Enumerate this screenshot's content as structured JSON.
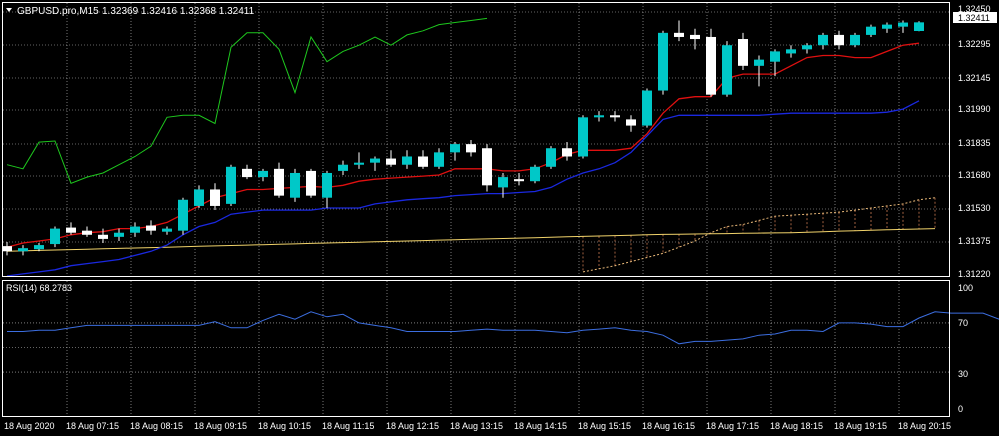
{
  "header": {
    "symbol_timeframe": "GBPUSD.pro,M15",
    "ohlc": "1.32369 1.32416 1.32368 1.32411",
    "menu_icon": "triangle-down-icon"
  },
  "price_axis": {
    "labels": [
      "1.32450",
      "1.32295",
      "1.32145",
      "1.31990",
      "1.31835",
      "1.31680",
      "1.31530",
      "1.31375",
      "1.31220"
    ],
    "current_price": "1.32411"
  },
  "rsi": {
    "label": "RSI(14) 68.2783",
    "levels": [
      "100",
      "70",
      "30",
      "0"
    ],
    "values": [
      63,
      63,
      64,
      64,
      66,
      68,
      68,
      68,
      68,
      68,
      68,
      68,
      68,
      71,
      66,
      66,
      72,
      77,
      73,
      79,
      75,
      77,
      70,
      68,
      66,
      63,
      63,
      63,
      63,
      64,
      65,
      64,
      64,
      64,
      63,
      62,
      64,
      65,
      66,
      64,
      63,
      60,
      53,
      55,
      55,
      56,
      57,
      60,
      61,
      64,
      64,
      63,
      70,
      70,
      69,
      67,
      67,
      74,
      79,
      78,
      78,
      78,
      73,
      63,
      67,
      66,
      65,
      65,
      66,
      67,
      66,
      65,
      65,
      65,
      66,
      67,
      64,
      67,
      67,
      66,
      67,
      67,
      68,
      68,
      68
    ]
  },
  "time_axis": {
    "labels": [
      "18 Aug 2020",
      "18 Aug 07:15",
      "18 Aug 08:15",
      "18 Aug 09:15",
      "18 Aug 10:15",
      "18 Aug 11:15",
      "18 Aug 12:15",
      "18 Aug 13:15",
      "18 Aug 14:15",
      "18 Aug 15:15",
      "18 Aug 16:15",
      "18 Aug 17:15",
      "18 Aug 18:15",
      "18 Aug 19:15",
      "18 Aug 20:15"
    ]
  },
  "colors": {
    "background": "#000000",
    "grid": "#c8c8c8",
    "candle_up": "#00c8c8",
    "candle_down": "#ffffff",
    "tenkan": "#e01010",
    "kijun": "#1a28e0",
    "chikou": "#1ec81e",
    "span_a": "#f0d26a",
    "span_b": "#e8b878",
    "cloud_hatch": "#c87850",
    "rsi_line": "#3c6ee0",
    "price_marker": "#ffffff"
  },
  "chart_data": {
    "type": "candlestick",
    "x_start": "18 Aug 2020 06:30",
    "interval": "15 minutes",
    "ylim": [
      1.3118,
      1.325
    ],
    "candles": [
      [
        1.31325,
        1.31345,
        1.3128,
        1.313
      ],
      [
        1.313,
        1.3133,
        1.3128,
        1.31315
      ],
      [
        1.3131,
        1.3134,
        1.313,
        1.3133
      ],
      [
        1.31335,
        1.3142,
        1.3132,
        1.3141
      ],
      [
        1.31415,
        1.3144,
        1.3138,
        1.3139
      ],
      [
        1.314,
        1.3142,
        1.3137,
        1.3138
      ],
      [
        1.3138,
        1.3141,
        1.3134,
        1.3136
      ],
      [
        1.3137,
        1.3141,
        1.3135,
        1.3139
      ],
      [
        1.3139,
        1.3144,
        1.3137,
        1.3142
      ],
      [
        1.31425,
        1.3145,
        1.3138,
        1.314
      ],
      [
        1.31395,
        1.3142,
        1.3138,
        1.3141
      ],
      [
        1.314,
        1.3156,
        1.3138,
        1.3155
      ],
      [
        1.3152,
        1.3162,
        1.3151,
        1.316
      ],
      [
        1.316,
        1.3163,
        1.315,
        1.3152
      ],
      [
        1.3153,
        1.3172,
        1.3152,
        1.3171
      ],
      [
        1.317,
        1.3172,
        1.3165,
        1.3166
      ],
      [
        1.3166,
        1.317,
        1.3164,
        1.3169
      ],
      [
        1.317,
        1.3173,
        1.3156,
        1.3157
      ],
      [
        1.3156,
        1.317,
        1.3154,
        1.3168
      ],
      [
        1.3169,
        1.317,
        1.3156,
        1.3157
      ],
      [
        1.3156,
        1.3169,
        1.3151,
        1.3168
      ],
      [
        1.3169,
        1.3174,
        1.3167,
        1.3172
      ],
      [
        1.3172,
        1.3178,
        1.317,
        1.3173
      ],
      [
        1.3173,
        1.3176,
        1.3169,
        1.3175
      ],
      [
        1.3175,
        1.3179,
        1.3171,
        1.3172
      ],
      [
        1.3172,
        1.3179,
        1.317,
        1.3176
      ],
      [
        1.3176,
        1.3179,
        1.317,
        1.3171
      ],
      [
        1.3171,
        1.318,
        1.317,
        1.3178
      ],
      [
        1.3178,
        1.3183,
        1.3174,
        1.3182
      ],
      [
        1.3182,
        1.3184,
        1.3176,
        1.3178
      ],
      [
        1.318,
        1.3182,
        1.3159,
        1.3162
      ],
      [
        1.3161,
        1.3168,
        1.3156,
        1.3166
      ],
      [
        1.3165,
        1.3168,
        1.3162,
        1.3164
      ],
      [
        1.3164,
        1.3172,
        1.3163,
        1.3171
      ],
      [
        1.3171,
        1.3181,
        1.317,
        1.318
      ],
      [
        1.318,
        1.3183,
        1.3174,
        1.3176
      ],
      [
        1.3176,
        1.3196,
        1.3175,
        1.3195
      ],
      [
        1.3195,
        1.3198,
        1.3193,
        1.3196
      ],
      [
        1.3196,
        1.3198,
        1.3193,
        1.3195
      ],
      [
        1.3194,
        1.3196,
        1.3188,
        1.3191
      ],
      [
        1.3191,
        1.3209,
        1.319,
        1.3208
      ],
      [
        1.3208,
        1.3237,
        1.3206,
        1.3236
      ],
      [
        1.3236,
        1.3242,
        1.3232,
        1.3234
      ],
      [
        1.3235,
        1.3238,
        1.3228,
        1.3233
      ],
      [
        1.3234,
        1.3238,
        1.3205,
        1.3206
      ],
      [
        1.3206,
        1.3232,
        1.3205,
        1.323
      ],
      [
        1.3233,
        1.3236,
        1.3218,
        1.322
      ],
      [
        1.322,
        1.3225,
        1.321,
        1.3223
      ],
      [
        1.3222,
        1.3228,
        1.3215,
        1.3227
      ],
      [
        1.3226,
        1.323,
        1.3224,
        1.3228
      ],
      [
        1.3228,
        1.3231,
        1.3226,
        1.323
      ],
      [
        1.323,
        1.3236,
        1.3228,
        1.3235
      ],
      [
        1.3235,
        1.3237,
        1.3228,
        1.323
      ],
      [
        1.323,
        1.3236,
        1.3229,
        1.3235
      ],
      [
        1.3235,
        1.324,
        1.3234,
        1.3239
      ],
      [
        1.3238,
        1.3241,
        1.3236,
        1.324
      ],
      [
        1.3239,
        1.3242,
        1.3236,
        1.3241
      ],
      [
        1.32369,
        1.32416,
        1.32368,
        1.32411
      ]
    ],
    "tenkan": [
      1.3132,
      1.3134,
      1.3135,
      1.3136,
      1.3138,
      1.3139,
      1.31395,
      1.3141,
      1.3141,
      1.3142,
      1.3144,
      1.3148,
      1.3152,
      1.3156,
      1.3158,
      1.316,
      1.316,
      1.31605,
      1.3161,
      1.31615,
      1.3161,
      1.3162,
      1.3164,
      1.3165,
      1.31655,
      1.3166,
      1.31665,
      1.3167,
      1.317,
      1.317,
      1.317,
      1.3169,
      1.3169,
      1.317,
      1.3173,
      1.3177,
      1.3179,
      1.3179,
      1.3179,
      1.318,
      1.3187,
      1.3197,
      1.3204,
      1.3205,
      1.3205,
      1.3214,
      1.3216,
      1.3216,
      1.3216,
      1.322,
      1.3224,
      1.3225,
      1.3225,
      1.3224,
      1.3224,
      1.3227,
      1.323,
      1.3231
    ],
    "kijun": [
      1.3118,
      1.3119,
      1.312,
      1.3121,
      1.3123,
      1.3124,
      1.3125,
      1.3126,
      1.3128,
      1.313,
      1.3133,
      1.3138,
      1.3142,
      1.3144,
      1.3148,
      1.3149,
      1.315,
      1.315,
      1.315,
      1.315,
      1.3151,
      1.3151,
      1.3151,
      1.3153,
      1.3154,
      1.3155,
      1.31555,
      1.3156,
      1.3157,
      1.31575,
      1.3158,
      1.3158,
      1.31585,
      1.3159,
      1.3161,
      1.3165,
      1.3168,
      1.317,
      1.3173,
      1.3178,
      1.3186,
      1.3194,
      1.3196,
      1.3196,
      1.3196,
      1.3196,
      1.3196,
      1.3196,
      1.31965,
      1.3197,
      1.3197,
      1.3197,
      1.3197,
      1.3197,
      1.3197,
      1.31975,
      1.3199,
      1.3203
    ],
    "chikou": [
      1.3172,
      1.317,
      1.3183,
      1.31835,
      1.3163,
      1.3166,
      1.3168,
      1.3172,
      1.3176,
      1.3181,
      1.3195,
      1.3196,
      1.3196,
      1.3192,
      1.3229,
      1.3236,
      1.3236,
      1.3228,
      1.3207,
      1.3234,
      1.3222,
      1.3227,
      1.323,
      1.3234,
      1.323,
      1.3235,
      1.3237,
      1.324,
      1.3241,
      1.3242,
      1.3243
    ],
    "span_a": [
      1.313,
      1.31302,
      1.31304,
      1.31306,
      1.31308,
      1.3131,
      1.31312,
      1.31314,
      1.31316,
      1.31318,
      1.3132,
      1.31322,
      1.31324,
      1.31326,
      1.31328,
      1.3133,
      1.31332,
      1.31334,
      1.31336,
      1.31338,
      1.3134,
      1.31342,
      1.31344,
      1.31346,
      1.31348,
      1.3135,
      1.31352,
      1.31354,
      1.31356,
      1.31358,
      1.3136,
      1.31362,
      1.31364,
      1.31366,
      1.31368,
      1.3137,
      1.31372,
      1.31374,
      1.31376,
      1.31378,
      1.3138,
      1.31382,
      1.31383,
      1.31384,
      1.31385,
      1.31386,
      1.31387,
      1.31388,
      1.31389,
      1.3139,
      1.31392,
      1.31395,
      1.31398,
      1.314,
      1.31402,
      1.31404,
      1.31406,
      1.31408,
      1.3141,
      1.31412,
      1.31414,
      1.31416,
      1.31418,
      1.3142,
      1.31422,
      1.31425,
      1.31428,
      1.3143,
      1.31432,
      1.31434,
      1.31436,
      1.31438,
      1.3144,
      1.3144,
      1.3144,
      1.3144,
      1.3144,
      1.3144,
      1.3144,
      1.3144,
      1.3144,
      1.3144,
      1.3144,
      1.3144
    ],
    "span_b_offset": 36,
    "span_b": [
      1.312,
      1.31215,
      1.3123,
      1.3125,
      1.3127,
      1.3129,
      1.3132,
      1.3135,
      1.3139,
      1.3142,
      1.3143,
      1.3145,
      1.3147,
      1.31475,
      1.3148,
      1.31485,
      1.3149,
      1.315,
      1.3151,
      1.3152,
      1.3153,
      1.3155,
      1.3156,
      1.3157,
      1.3158,
      1.31585,
      1.3159,
      1.316,
      1.3161,
      1.31615,
      1.3162,
      1.31625,
      1.3163,
      1.3163,
      1.31625,
      1.3162,
      1.3162,
      1.31625,
      1.3163,
      1.3163,
      1.3163,
      1.3163,
      1.3163,
      1.3163,
      1.3163,
      1.3163,
      1.3163,
      1.3163
    ],
    "lower_line_offset": 72,
    "lower_line": [
      1.3121,
      1.31215,
      1.3122,
      1.31225,
      1.3123,
      1.31235,
      1.3124,
      1.31245,
      1.31248,
      1.3125,
      1.31252,
      1.31254
    ]
  }
}
